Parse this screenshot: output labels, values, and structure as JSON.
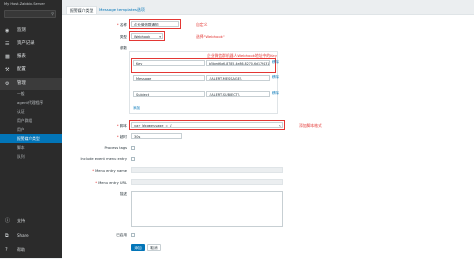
{
  "sidebar": {
    "brand": "My Host.Zabbix.Server",
    "search_placeholder": "",
    "menu": [
      {
        "icon": "eye-icon",
        "label": "监测"
      },
      {
        "icon": "list-icon",
        "label": "资产记录"
      },
      {
        "icon": "chart-icon",
        "label": "报表"
      },
      {
        "icon": "wrench-icon",
        "label": "配置"
      },
      {
        "icon": "gear-icon",
        "label": "管理"
      }
    ],
    "submenu": [
      "一般",
      "agent代理程序",
      "认证",
      "用户群组",
      "用户",
      "报警媒介类型",
      "脚本",
      "队列"
    ],
    "bottom": [
      {
        "icon": "help-icon",
        "label": "支持"
      },
      {
        "icon": "share-icon",
        "label": "Share"
      },
      {
        "icon": "question-icon",
        "label": "帮助"
      }
    ]
  },
  "tabs": [
    "报警媒介类型",
    "Message templates",
    "选项"
  ],
  "form": {
    "name_label": "名称",
    "name_value": "企业微信群通知",
    "name_note": "自定义",
    "type_label": "类型",
    "type_value": "Webhook",
    "type_note": "选择\"Webhook\"",
    "params_label": "参数",
    "params_note": "企业微信群机器人Webhook地址中的Key",
    "params": [
      {
        "name": "Key",
        "value": "b5bed6a6-8785-4e86-8270-6d17f431"
      },
      {
        "name": "Message",
        "value": "{ALERT.MESSAGE}"
      },
      {
        "name": "Subject",
        "value": "{ALERT.SUBJECT}"
      }
    ],
    "remove_label": "移除",
    "add_label": "添加",
    "script_label": "脚本",
    "script_value": "var Wxgmessage = {",
    "script_note": "添加脚本格式",
    "timeout_label": "超时",
    "timeout_value": "30s",
    "process_tags_label": "Process tags",
    "include_event_label": "Include event menu entry",
    "menu_entry_name_label": "Menu entry name",
    "menu_entry_url_label": "Menu entry URL",
    "description_label": "描述",
    "enabled_label": "已启用",
    "add_button": "添加",
    "cancel_button": "取消"
  }
}
